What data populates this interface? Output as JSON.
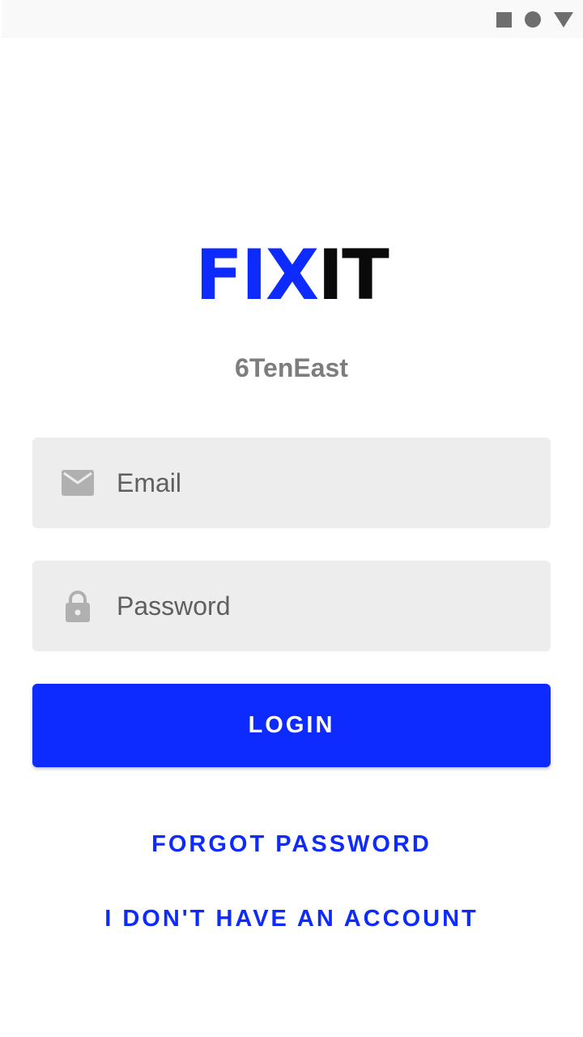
{
  "status_bar": {
    "icons": [
      "square-icon",
      "circle-icon",
      "triangle-icon"
    ],
    "icon_color": "#6e6e6e"
  },
  "brand": {
    "logo_part_1": "FIX",
    "logo_part_2": "IT",
    "logo_color_1": "#0d2aff",
    "logo_color_2": "#0a0a0a",
    "subtitle": "6TenEast"
  },
  "form": {
    "email": {
      "placeholder": "Email",
      "value": "",
      "icon": "envelope-icon"
    },
    "password": {
      "placeholder": "Password",
      "value": "",
      "icon": "lock-icon"
    },
    "login_label": "LOGIN"
  },
  "links": {
    "forgot_password": "FORGOT PASSWORD",
    "no_account": "I DON'T HAVE AN ACCOUNT"
  },
  "colors": {
    "accent": "#0d2aff",
    "field_background": "#ededed",
    "icon_gray": "#b0b0b0",
    "subtitle_gray": "#7d7d7d"
  }
}
